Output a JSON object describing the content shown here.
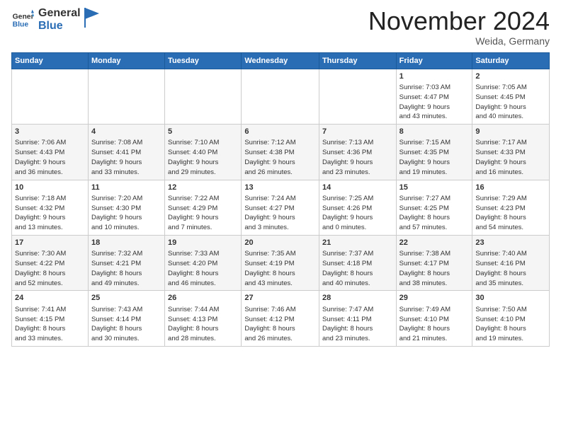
{
  "header": {
    "logo_general": "General",
    "logo_blue": "Blue",
    "month_title": "November 2024",
    "subtitle": "Weida, Germany"
  },
  "weekdays": [
    "Sunday",
    "Monday",
    "Tuesday",
    "Wednesday",
    "Thursday",
    "Friday",
    "Saturday"
  ],
  "weeks": [
    [
      {
        "day": "",
        "info": ""
      },
      {
        "day": "",
        "info": ""
      },
      {
        "day": "",
        "info": ""
      },
      {
        "day": "",
        "info": ""
      },
      {
        "day": "",
        "info": ""
      },
      {
        "day": "1",
        "info": "Sunrise: 7:03 AM\nSunset: 4:47 PM\nDaylight: 9 hours\nand 43 minutes."
      },
      {
        "day": "2",
        "info": "Sunrise: 7:05 AM\nSunset: 4:45 PM\nDaylight: 9 hours\nand 40 minutes."
      }
    ],
    [
      {
        "day": "3",
        "info": "Sunrise: 7:06 AM\nSunset: 4:43 PM\nDaylight: 9 hours\nand 36 minutes."
      },
      {
        "day": "4",
        "info": "Sunrise: 7:08 AM\nSunset: 4:41 PM\nDaylight: 9 hours\nand 33 minutes."
      },
      {
        "day": "5",
        "info": "Sunrise: 7:10 AM\nSunset: 4:40 PM\nDaylight: 9 hours\nand 29 minutes."
      },
      {
        "day": "6",
        "info": "Sunrise: 7:12 AM\nSunset: 4:38 PM\nDaylight: 9 hours\nand 26 minutes."
      },
      {
        "day": "7",
        "info": "Sunrise: 7:13 AM\nSunset: 4:36 PM\nDaylight: 9 hours\nand 23 minutes."
      },
      {
        "day": "8",
        "info": "Sunrise: 7:15 AM\nSunset: 4:35 PM\nDaylight: 9 hours\nand 19 minutes."
      },
      {
        "day": "9",
        "info": "Sunrise: 7:17 AM\nSunset: 4:33 PM\nDaylight: 9 hours\nand 16 minutes."
      }
    ],
    [
      {
        "day": "10",
        "info": "Sunrise: 7:18 AM\nSunset: 4:32 PM\nDaylight: 9 hours\nand 13 minutes."
      },
      {
        "day": "11",
        "info": "Sunrise: 7:20 AM\nSunset: 4:30 PM\nDaylight: 9 hours\nand 10 minutes."
      },
      {
        "day": "12",
        "info": "Sunrise: 7:22 AM\nSunset: 4:29 PM\nDaylight: 9 hours\nand 7 minutes."
      },
      {
        "day": "13",
        "info": "Sunrise: 7:24 AM\nSunset: 4:27 PM\nDaylight: 9 hours\nand 3 minutes."
      },
      {
        "day": "14",
        "info": "Sunrise: 7:25 AM\nSunset: 4:26 PM\nDaylight: 9 hours\nand 0 minutes."
      },
      {
        "day": "15",
        "info": "Sunrise: 7:27 AM\nSunset: 4:25 PM\nDaylight: 8 hours\nand 57 minutes."
      },
      {
        "day": "16",
        "info": "Sunrise: 7:29 AM\nSunset: 4:23 PM\nDaylight: 8 hours\nand 54 minutes."
      }
    ],
    [
      {
        "day": "17",
        "info": "Sunrise: 7:30 AM\nSunset: 4:22 PM\nDaylight: 8 hours\nand 52 minutes."
      },
      {
        "day": "18",
        "info": "Sunrise: 7:32 AM\nSunset: 4:21 PM\nDaylight: 8 hours\nand 49 minutes."
      },
      {
        "day": "19",
        "info": "Sunrise: 7:33 AM\nSunset: 4:20 PM\nDaylight: 8 hours\nand 46 minutes."
      },
      {
        "day": "20",
        "info": "Sunrise: 7:35 AM\nSunset: 4:19 PM\nDaylight: 8 hours\nand 43 minutes."
      },
      {
        "day": "21",
        "info": "Sunrise: 7:37 AM\nSunset: 4:18 PM\nDaylight: 8 hours\nand 40 minutes."
      },
      {
        "day": "22",
        "info": "Sunrise: 7:38 AM\nSunset: 4:17 PM\nDaylight: 8 hours\nand 38 minutes."
      },
      {
        "day": "23",
        "info": "Sunrise: 7:40 AM\nSunset: 4:16 PM\nDaylight: 8 hours\nand 35 minutes."
      }
    ],
    [
      {
        "day": "24",
        "info": "Sunrise: 7:41 AM\nSunset: 4:15 PM\nDaylight: 8 hours\nand 33 minutes."
      },
      {
        "day": "25",
        "info": "Sunrise: 7:43 AM\nSunset: 4:14 PM\nDaylight: 8 hours\nand 30 minutes."
      },
      {
        "day": "26",
        "info": "Sunrise: 7:44 AM\nSunset: 4:13 PM\nDaylight: 8 hours\nand 28 minutes."
      },
      {
        "day": "27",
        "info": "Sunrise: 7:46 AM\nSunset: 4:12 PM\nDaylight: 8 hours\nand 26 minutes."
      },
      {
        "day": "28",
        "info": "Sunrise: 7:47 AM\nSunset: 4:11 PM\nDaylight: 8 hours\nand 23 minutes."
      },
      {
        "day": "29",
        "info": "Sunrise: 7:49 AM\nSunset: 4:10 PM\nDaylight: 8 hours\nand 21 minutes."
      },
      {
        "day": "30",
        "info": "Sunrise: 7:50 AM\nSunset: 4:10 PM\nDaylight: 8 hours\nand 19 minutes."
      }
    ]
  ]
}
